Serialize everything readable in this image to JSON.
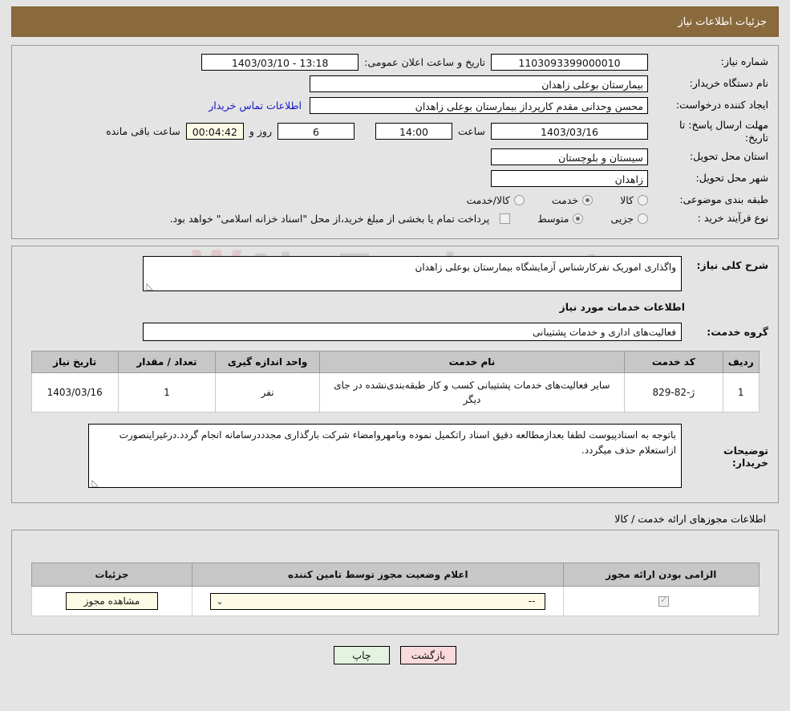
{
  "titlebar": {
    "title": "جزئیات اطلاعات نیاز"
  },
  "watermark": {
    "text": "AhaTender.net",
    "mark": "W"
  },
  "form": {
    "need_number_label": "شماره نیاز:",
    "need_number_value": "1103093399000010",
    "announce_label": "تاریخ و ساعت اعلان عمومی:",
    "announce_value": "1403/03/10 - 13:18",
    "buyer_org_label": "نام دستگاه خریدار:",
    "buyer_org_value": "بیمارستان بوعلی زاهدان",
    "creator_label": "ایجاد کننده درخواست:",
    "creator_value": "محسن وحدانی مقدم کارپرداز بیمارستان بوعلی زاهدان",
    "contact_link": "اطلاعات تماس خریدار",
    "deadline_label": "مهلت ارسال پاسخ: تا تاریخ:",
    "deadline_date": "1403/03/16",
    "hour_word": "ساعت",
    "deadline_time": "14:00",
    "days_remaining": "6",
    "days_word": "روز و",
    "countdown": "00:04:42",
    "hours_remaining_word": "ساعت باقی مانده",
    "province_label": "استان محل تحویل:",
    "province_value": "سیستان و بلوچستان",
    "city_label": "شهر محل تحویل:",
    "city_value": "زاهدان",
    "category_label": "طبقه بندی موضوعی:",
    "category_options": [
      {
        "label": "کالا",
        "selected": false
      },
      {
        "label": "خدمت",
        "selected": true
      },
      {
        "label": "کالا/خدمت",
        "selected": false
      }
    ],
    "process_label": "نوع فرآیند خرید :",
    "process_options": [
      {
        "label": "جزیی",
        "selected": false
      },
      {
        "label": "متوسط",
        "selected": true
      }
    ],
    "payment_checkbox_checked": false,
    "payment_note": "پرداخت تمام یا بخشی از مبلغ خرید،از محل \"اسناد خزانه اسلامی\" خواهد بود."
  },
  "description": {
    "need_summary_label": "شرح کلی نیاز:",
    "need_summary_value": "واگذاری اموریک نفرکارشناس آزمایشگاه بیمارستان بوعلی زاهدان",
    "services_section_title": "اطلاعات خدمات مورد نیاز",
    "service_group_label": "گروه خدمت:",
    "service_group_value": "فعالیت‌های اداری و خدمات پشتیبانی",
    "buyer_notes_label": "توضیحات خریدار:",
    "buyer_notes_value": "باتوجه به اسنادپیوست لطفا بعدازمطالعه دقیق  اسناد راتکمیل نموده وبامهروامضاء شرکت بارگذاری مجدددرسامانه انجام گردد.درغیراینصورت ازاستعلام حذف میگردد.",
    "resize_grip": "◺"
  },
  "services_table": {
    "headers": [
      "ردیف",
      "کد خدمت",
      "نام خدمت",
      "واحد اندازه گیری",
      "تعداد / مقدار",
      "تاریخ نیاز"
    ],
    "rows": [
      {
        "index": "1",
        "code": "ژ-82-829",
        "name": "سایر فعالیت‌های خدمات پشتیبانی کسب و کار طبقه‌بندی‌نشده در جای دیگر",
        "unit": "نفر",
        "quantity": "1",
        "need_date": "1403/03/16"
      }
    ]
  },
  "permits": {
    "section_title": "اطلاعات مجوزهای ارائه خدمت / کالا",
    "headers": [
      "الزامی بودن ارائه مجوز",
      "اعلام وضعیت مجوز توسط تامین کننده",
      "جزئیات"
    ],
    "rows": [
      {
        "required_checked": true,
        "status_value": "--",
        "details_button": "مشاهده مجوز"
      }
    ],
    "caret_icon": "⌄"
  },
  "footer": {
    "back_label": "بازگشت",
    "print_label": "چاپ"
  },
  "colors": {
    "titlebar_bg": "#8a6a3d",
    "page_bg": "#e4e4e4",
    "link": "#1414c8",
    "back_btn": "#fadadd",
    "print_btn": "#e4f2e0",
    "cream_field": "#fdfbe6",
    "table_header": "#c7c7c7"
  }
}
